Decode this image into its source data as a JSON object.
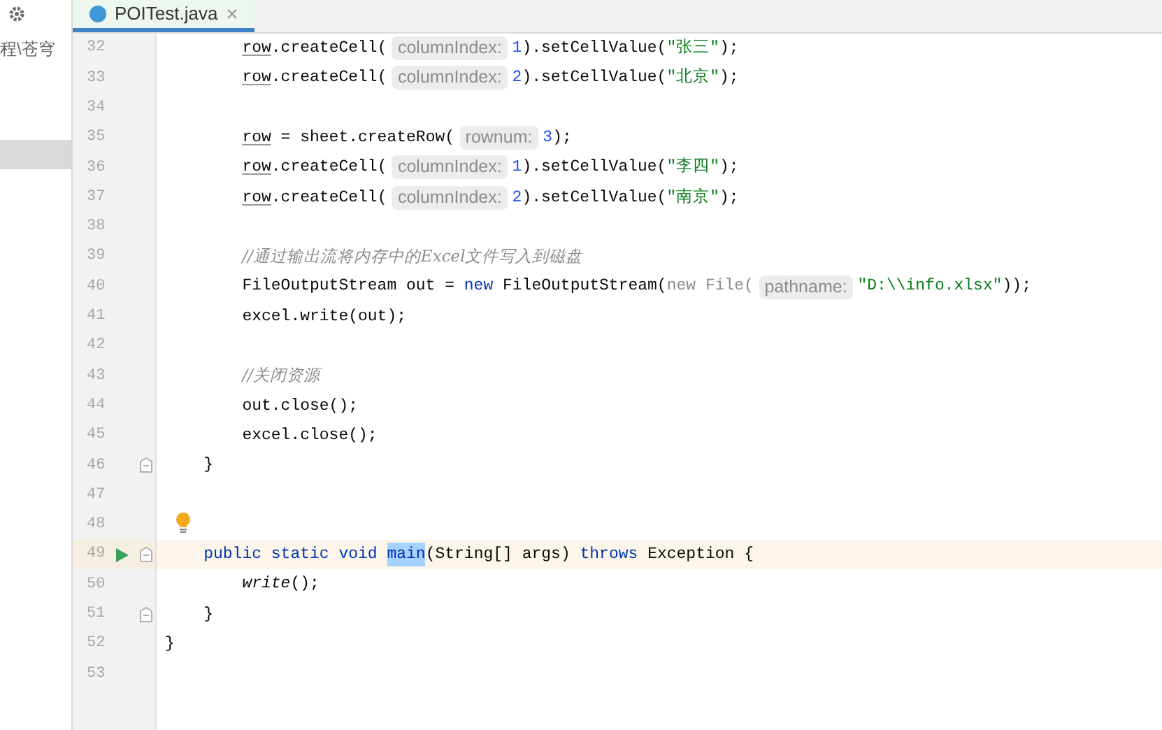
{
  "project_panel": {
    "path": "程\\苍穹"
  },
  "editor_tab": {
    "title": "POITest.java",
    "selected": true
  },
  "lines": [
    {
      "number": "32",
      "current": false,
      "tokens": [
        {
          "text": "        row",
          "kind": "var"
        },
        {
          "text": ".createCell(",
          "kind": "plain"
        },
        {
          "text": "columnIndex:",
          "kind": "hint"
        },
        {
          "text": "1",
          "kind": "number"
        },
        {
          "text": ").setCellValue(",
          "kind": "plain"
        },
        {
          "text": "\"张三\"",
          "kind": "string"
        },
        {
          "text": ");",
          "kind": "plain"
        }
      ]
    },
    {
      "number": "33",
      "current": false,
      "tokens": [
        {
          "text": "        row",
          "kind": "var"
        },
        {
          "text": ".createCell(",
          "kind": "plain"
        },
        {
          "text": "columnIndex:",
          "kind": "hint"
        },
        {
          "text": "2",
          "kind": "number"
        },
        {
          "text": ").setCellValue(",
          "kind": "plain"
        },
        {
          "text": "\"北京\"",
          "kind": "string"
        },
        {
          "text": ");",
          "kind": "plain"
        }
      ]
    },
    {
      "number": "34",
      "current": false
    },
    {
      "number": "35",
      "current": false,
      "tokens": [
        {
          "text": "        row",
          "kind": "var"
        },
        {
          "text": "= sheet.createRow(",
          "kind": "plain"
        },
        {
          "text": "rownum:",
          "kind": "hint"
        },
        {
          "text": "3",
          "kind": "number"
        },
        {
          "text": ");",
          "kind": "plain"
        }
      ]
    },
    {
      "number": "36",
      "current": false,
      "tokens": [
        {
          "text": "        row",
          "kind": "var"
        },
        {
          "text": ".createCell(",
          "kind": "plain"
        },
        {
          "text": "columnIndex:",
          "kind": "hint"
        },
        {
          "text": "1",
          "kind": "number"
        },
        {
          "text": ").setCellValue(",
          "kind": "plain"
        },
        {
          "text": "\"李四\"",
          "kind": "string"
        },
        {
          "text": ");",
          "kind": "plain"
        }
      ]
    },
    {
      "number": "37",
      "current": false,
      "tokens": [
        {
          "text": "        row",
          "kind": "var"
        },
        {
          "text": ".createCell(",
          "kind": "plain"
        },
        {
          "text": "columnIndex:",
          "kind": "hint"
        },
        {
          "text": "2",
          "kind": "number"
        },
        {
          "text": ").setCellValue(",
          "kind": "plain"
        },
        {
          "text": "\"南京\"",
          "kind": "string"
        },
        {
          "text": ");",
          "kind": "plain"
        }
      ]
    },
    {
      "number": "38",
      "current": false
    },
    {
      "number": "39",
      "current": false,
      "tokens": [
        {
          "text": "        //通过输出流将内存中的Excel文件写入到磁盘",
          "kind": "comment"
        }
      ]
    },
    {
      "number": "40",
      "current": false,
      "tokens": [
        {
          "text": "        FileOutputStream out =",
          "kind": "plain"
        },
        {
          "text": "new",
          "kind": "keyword"
        },
        {
          "text": "FileOutputStream(",
          "kind": "plain"
        },
        {
          "text": "new File(",
          "kind": "muted"
        },
        {
          "text": "pathname:",
          "kind": "hint"
        },
        {
          "text": "\"D:\\\\info.xlsx\"",
          "kind": "string"
        },
        {
          "text": "));",
          "kind": "plain"
        }
      ]
    },
    {
      "number": "41",
      "current": false,
      "tokens": [
        {
          "text": "        excel.write(out);",
          "kind": "plain"
        }
      ]
    },
    {
      "number": "42",
      "current": false
    },
    {
      "number": "43",
      "current": false,
      "tokens": [
        {
          "text": "        //关闭资源",
          "kind": "comment"
        }
      ]
    },
    {
      "number": "44",
      "current": false,
      "tokens": [
        {
          "text": "        out.close();",
          "kind": "plain"
        }
      ]
    },
    {
      "number": "45",
      "current": false,
      "tokens": [
        {
          "text": "        excel.close();",
          "kind": "plain"
        }
      ]
    },
    {
      "number": "46",
      "current": false,
      "fold": true,
      "tokens": [
        {
          "text": "    }",
          "kind": "plain"
        }
      ]
    },
    {
      "number": "47",
      "current": false
    },
    {
      "number": "48",
      "current": false,
      "bulb": true
    },
    {
      "number": "49",
      "current": true,
      "run": true,
      "fold": true,
      "tokens": [
        {
          "text": "    public static void",
          "kind": "keyword"
        },
        {
          "text": "main",
          "kind": "selected"
        },
        {
          "text": "(String[] args)",
          "kind": "plain"
        },
        {
          "text": "throws",
          "kind": "keyword"
        },
        {
          "text": "Exception {",
          "kind": "plain"
        }
      ]
    },
    {
      "number": "50",
      "current": false,
      "tokens": [
        {
          "text": "        write",
          "kind": "static_call"
        },
        {
          "text": "();",
          "kind": "plain"
        }
      ]
    },
    {
      "number": "51",
      "current": false,
      "fold": true,
      "tokens": [
        {
          "text": "    }",
          "kind": "plain"
        }
      ]
    },
    {
      "number": "52",
      "current": false,
      "tokens": [
        {
          "text": "}",
          "kind": "plain"
        }
      ]
    },
    {
      "number": "53",
      "current": false
    }
  ]
}
